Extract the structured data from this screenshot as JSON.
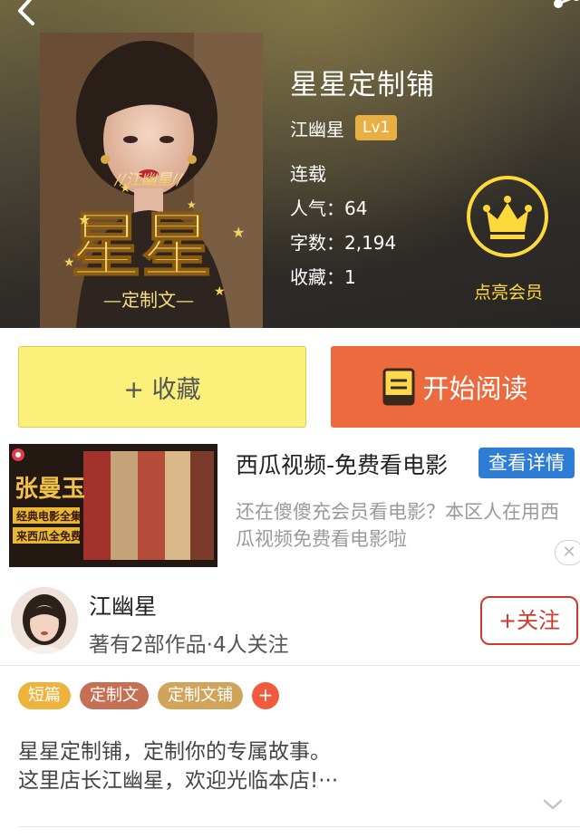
{
  "header": {
    "back_icon": "chevron-left-icon",
    "share_icon": "share-icon",
    "book_title": "星星定制铺",
    "author": "江幽星",
    "level": "Lv1",
    "status": "连载",
    "popularity": "人气：64",
    "word_count": "字数：2,194",
    "favorites": "收藏：1",
    "vip_label": "点亮会员",
    "vip_icon": "crown-icon",
    "cover_text": {
      "tagline": "江幽星",
      "main": "星星",
      "sub": "定制文"
    }
  },
  "actions": {
    "collect_label": "+ 收藏",
    "read_label": "开始阅读",
    "read_icon": "book-icon"
  },
  "ad": {
    "title": "西瓜视频-免费看电影",
    "detail_label": "查看详情",
    "description": "还在傻傻充会员看电影？本区人在用西瓜视频免费看电影啦",
    "close_icon": "close-icon",
    "image_text": {
      "star": "张曼玉",
      "line1": "经典电影全集",
      "line2": "来西瓜全免费"
    }
  },
  "author_section": {
    "name": "江幽星",
    "stats": "著有2部作品·4人关注",
    "follow_label": "+关注"
  },
  "tags": [
    {
      "label": "短篇",
      "color": "#eeb33c"
    },
    {
      "label": "定制文",
      "color": "#c57055"
    },
    {
      "label": "定制文铺",
      "color": "#d0a45a"
    }
  ],
  "tag_add_label": "+",
  "description": {
    "line1": "星星定制铺，定制你的专属故事。",
    "line2": "这里店长江幽星，欢迎光临本店!···"
  },
  "colors": {
    "collect_bg": "#faf07a",
    "read_bg": "#ec6a3d",
    "vip_gold": "#ffd93b",
    "follow_red": "#cf3a2a",
    "ad_blue": "#2d7cd6"
  }
}
